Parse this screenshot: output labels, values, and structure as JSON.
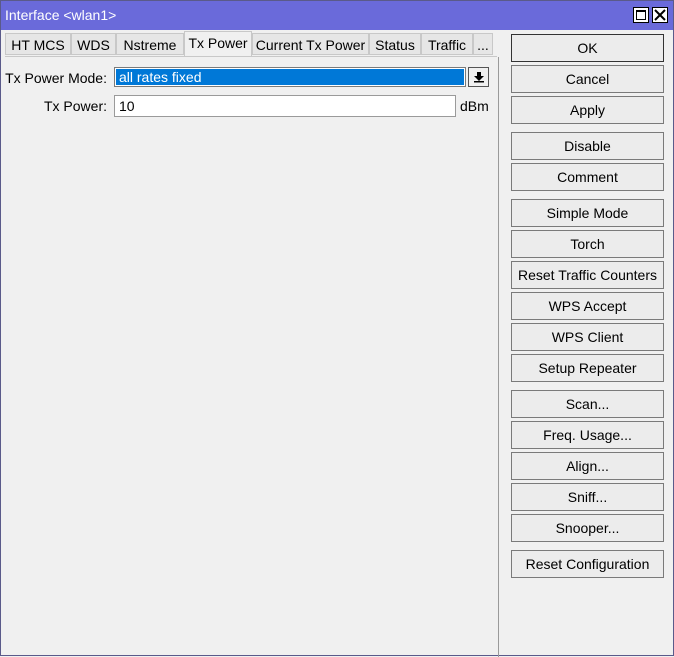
{
  "window": {
    "title": "Interface <wlan1>"
  },
  "tabs": [
    {
      "label": "HT MCS"
    },
    {
      "label": "WDS"
    },
    {
      "label": "Nstreme"
    },
    {
      "label": "Tx Power",
      "active": true
    },
    {
      "label": "Current Tx Power"
    },
    {
      "label": "Status"
    },
    {
      "label": "Traffic"
    },
    {
      "label": "..."
    }
  ],
  "form": {
    "tx_power_mode_label": "Tx Power Mode:",
    "tx_power_mode_value": "all rates fixed",
    "tx_power_label": "Tx Power:",
    "tx_power_value": "10",
    "tx_power_unit": "dBm"
  },
  "buttons": {
    "ok": "OK",
    "cancel": "Cancel",
    "apply": "Apply",
    "disable": "Disable",
    "comment": "Comment",
    "simple_mode": "Simple Mode",
    "torch": "Torch",
    "reset_traffic_counters": "Reset Traffic Counters",
    "wps_accept": "WPS Accept",
    "wps_client": "WPS Client",
    "setup_repeater": "Setup Repeater",
    "scan": "Scan...",
    "freq_usage": "Freq. Usage...",
    "align": "Align...",
    "sniff": "Sniff...",
    "snooper": "Snooper...",
    "reset_configuration": "Reset Configuration"
  },
  "colors": {
    "titlebar": "#6a6ada",
    "selection": "#0078d7"
  },
  "icons": [
    "maximize-icon",
    "close-icon",
    "dropdown-arrow-icon"
  ]
}
